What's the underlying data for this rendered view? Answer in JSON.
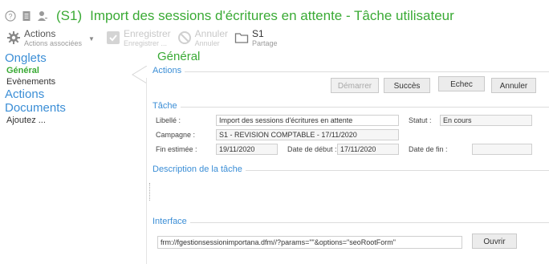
{
  "titlebar": {
    "icons": [
      "help-icon",
      "document-icon",
      "user-icon"
    ],
    "code": "(S1)",
    "title": "Import des sessions d'écritures en attente - Tâche utilisateur"
  },
  "toolbar": {
    "actions": {
      "label": "Actions",
      "sub": "Actions associées"
    },
    "save": {
      "label": "Enregistrer",
      "sub": "Enregistrer ..."
    },
    "cancel": {
      "label": "Annuler",
      "sub": "Annuler"
    },
    "share": {
      "label": "S1",
      "sub": "Partage"
    }
  },
  "sidebar": {
    "onglets_title": "Onglets",
    "items": [
      "Général",
      "Evènements"
    ],
    "actions_title": "Actions",
    "documents_title": "Documents",
    "add_label": "Ajoutez ..."
  },
  "main": {
    "section_title": "Général",
    "actions_group": "Actions",
    "buttons": {
      "start": "Démarrer",
      "success": "Succès",
      "fail": "Echec",
      "cancel": "Annuler"
    },
    "task_group": "Tâche",
    "fields": {
      "libelle_label": "Libellé :",
      "libelle_value": "Import des sessions d'écritures en attente",
      "statut_label": "Statut :",
      "statut_value": "En cours",
      "campagne_label": "Campagne :",
      "campagne_value": "S1 - REVISION COMPTABLE - 17/11/2020",
      "fin_estimee_label": "Fin estimée :",
      "fin_estimee_value": "19/11/2020",
      "date_debut_label": "Date de début :",
      "date_debut_value": "17/11/2020",
      "date_fin_label": "Date de fin :",
      "date_fin_value": ""
    },
    "description_group": "Description de la tâche",
    "interface_group": "Interface",
    "interface_value": "frm://fgestionsessionimportana.dfm//?params=\"\"&options=\"seoRootForm\"",
    "open_button": "Ouvrir"
  }
}
